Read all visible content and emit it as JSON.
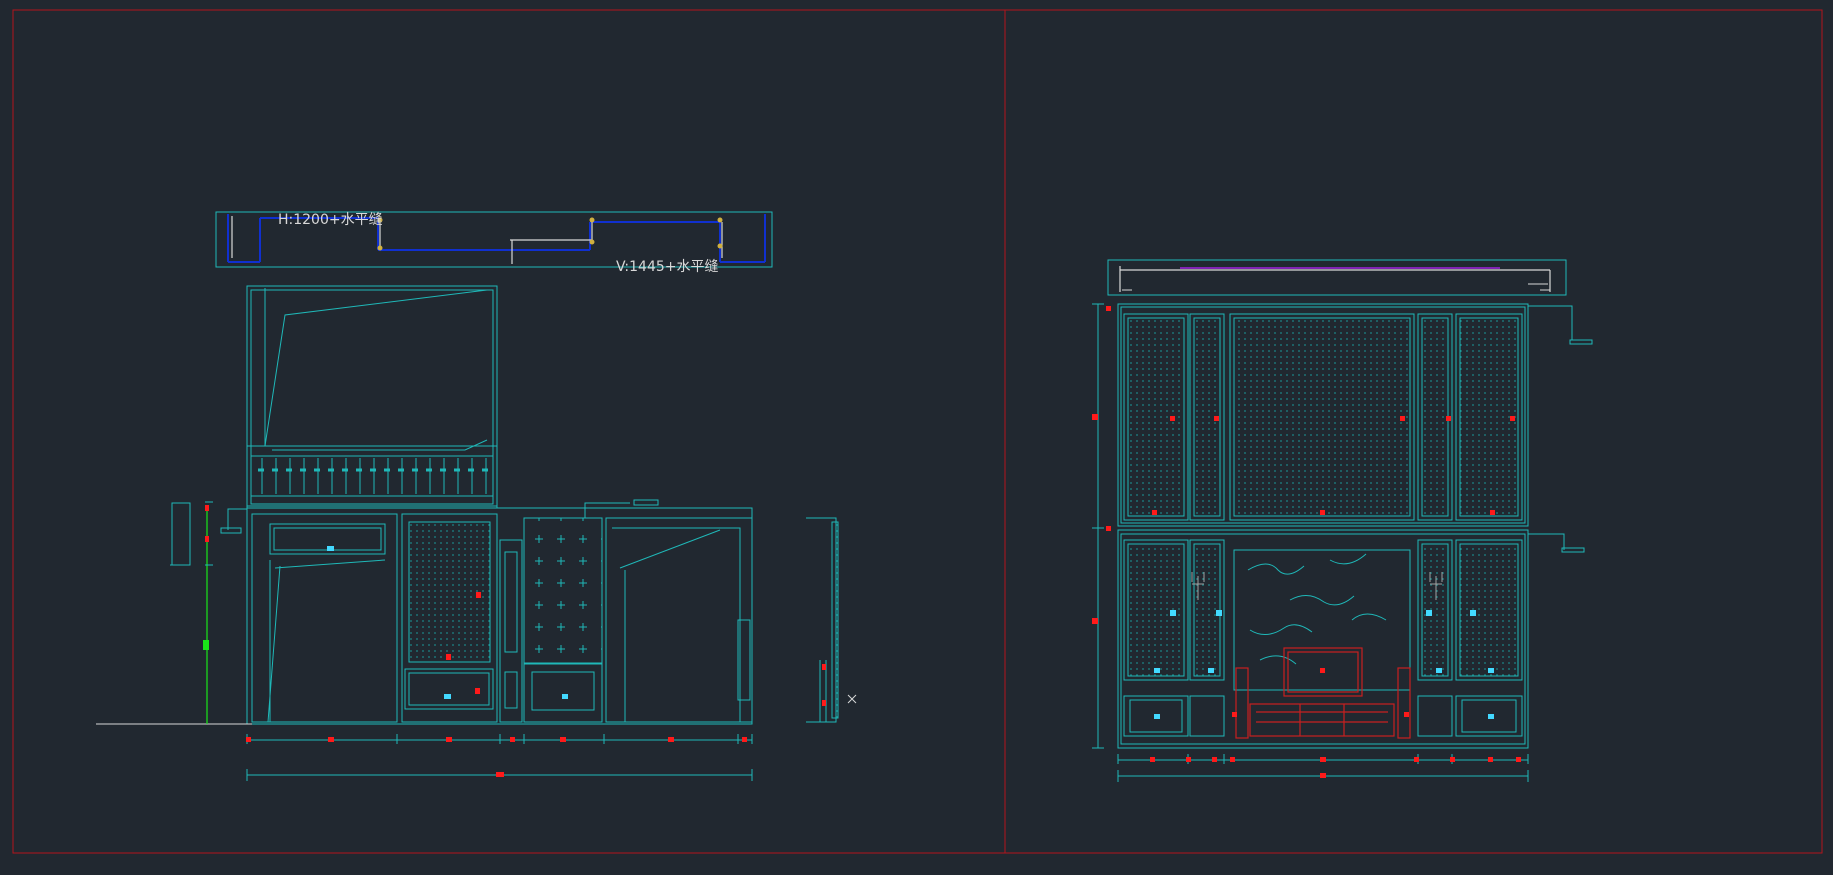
{
  "app": {
    "name": "CAD model space",
    "background": "#212830"
  },
  "colors": {
    "frame": "#b3141c",
    "cyan": "#1fb8b8",
    "cyan_dim": "#148a8a",
    "blue": "#1030d0",
    "magenta": "#a020e0",
    "red": "#ff1a1a",
    "green": "#19e619",
    "white": "#d8d8d8",
    "yellow": "#d0b040"
  },
  "left_view": {
    "label_top": "H:1200+水平缝",
    "label_bottom": "V:1445+水平缝"
  },
  "viewports": [
    {
      "id": "viewport-left"
    },
    {
      "id": "viewport-right"
    }
  ]
}
